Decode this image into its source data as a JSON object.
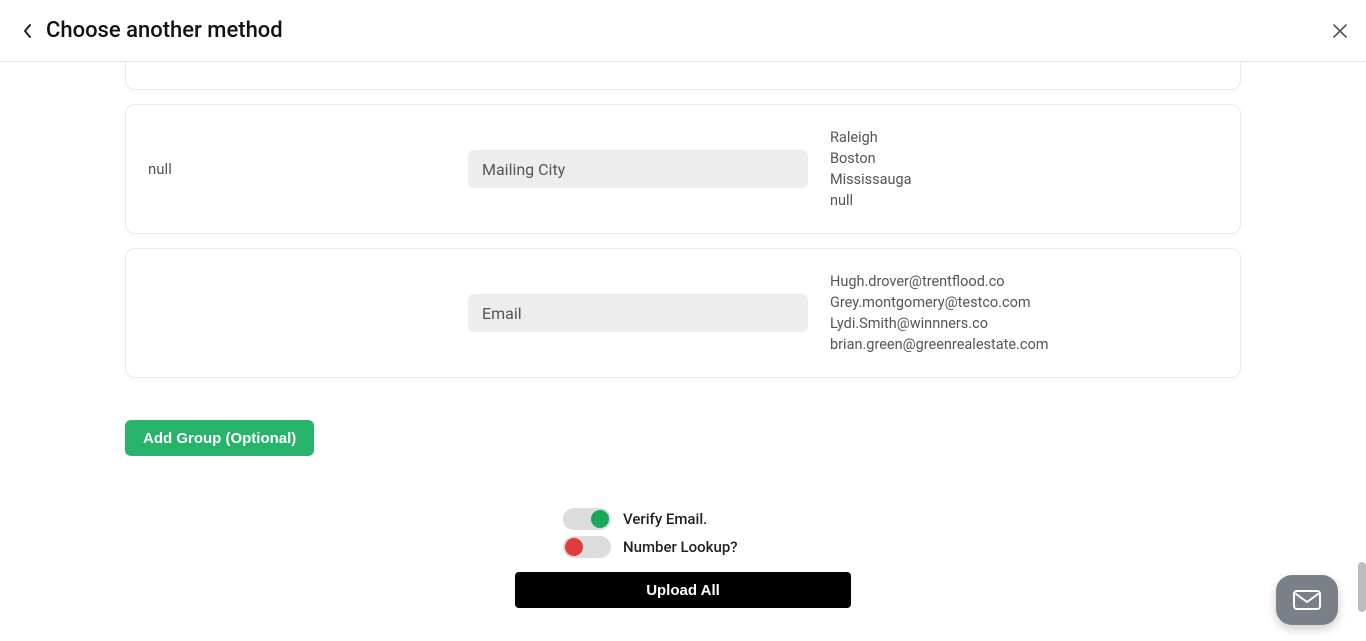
{
  "header": {
    "title": "Choose another method"
  },
  "mapping_rows": [
    {
      "source_value": "null",
      "field_label": "Mailing City",
      "samples": [
        "Raleigh",
        "Boston",
        "Mississauga",
        "null"
      ]
    },
    {
      "source_value": "",
      "field_label": "Email",
      "samples": [
        "Hugh.drover@trentflood.co",
        "Grey.montgomery@testco.com",
        "Lydi.Smith@winnners.co",
        "brian.green@greenrealestate.com"
      ]
    }
  ],
  "buttons": {
    "add_group": "Add Group (Optional)",
    "upload_all": "Upload All"
  },
  "toggles": {
    "verify_email": {
      "label": "Verify Email.",
      "on": true
    },
    "number_lookup": {
      "label": "Number Lookup?",
      "on": false
    }
  }
}
